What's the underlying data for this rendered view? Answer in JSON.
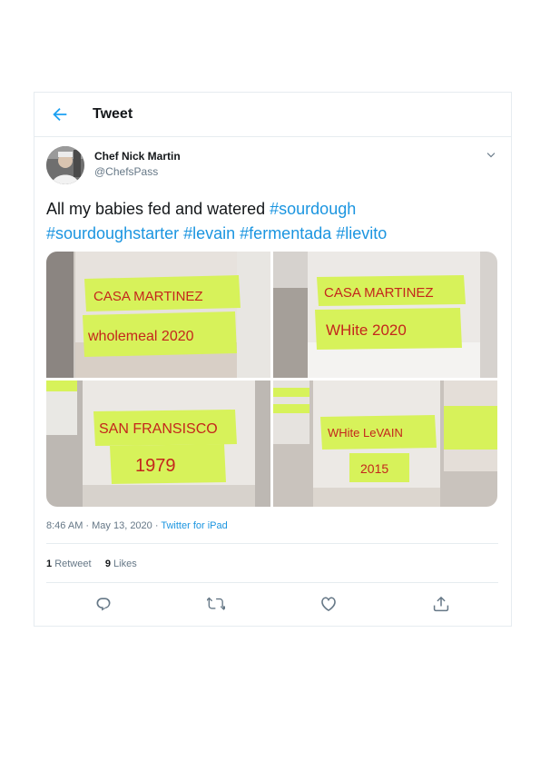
{
  "header": {
    "title": "Tweet",
    "back_icon": "arrow-left-icon"
  },
  "author": {
    "name": "Chef Nick Martin",
    "handle": "@ChefsPass",
    "avatar_icon": "avatar-photo"
  },
  "tweet": {
    "text_prefix": "All my babies fed and watered ",
    "hashtags": [
      "#sourdough",
      "#sourdoughstarter",
      "#levain",
      "#fermentada",
      "#lievito"
    ]
  },
  "photos": [
    {
      "lines": [
        "CASA MARTINEZ",
        "wholemeal 2020"
      ]
    },
    {
      "lines": [
        "CASA MARTINEZ",
        "WHite 2020"
      ]
    },
    {
      "lines": [
        "SAN FRANSISCO",
        "1979"
      ]
    },
    {
      "lines": [
        "WHite LeVAIN",
        "2015"
      ]
    }
  ],
  "meta": {
    "time": "8:46 AM · May 13, 2020 · ",
    "source": "Twitter for iPad"
  },
  "stats": {
    "retweets_count": "1",
    "retweets_label": "Retweet",
    "likes_count": "9",
    "likes_label": "Likes"
  },
  "actions": [
    "reply-icon",
    "retweet-icon",
    "like-icon",
    "share-icon"
  ],
  "colors": {
    "accent": "#1da1f2",
    "link": "#1b95e0",
    "label": "#d7f25a",
    "label_text": "#c4261c"
  }
}
